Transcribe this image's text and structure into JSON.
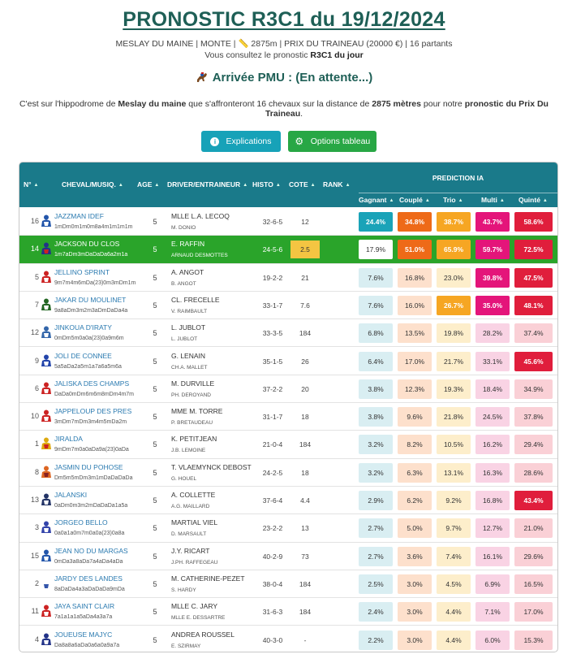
{
  "page": {
    "title": "PRONOSTIC R3C1 du 19/12/2024",
    "meta": "MESLAY DU MAINE | MONTE | 📏 2875m | PRIX DU TRAINEAU (20000 €) | 16 partants",
    "sub_prefix": "Vous consultez le pronostic ",
    "sub_bold": "R3C1 du jour",
    "arrivee": "Arrivée PMU : (En attente...)",
    "intro_1": "C'est sur l'hippodrome de ",
    "intro_place": "Meslay du maine",
    "intro_2": " que s'affronteront 16 chevaux sur la distance de ",
    "intro_dist": "2875 mètres",
    "intro_3": " pour notre ",
    "intro_prix": "pronostic du Prix Du Traineau",
    "intro_4": "."
  },
  "buttons": {
    "explications": "Explications",
    "options": "Options tableau"
  },
  "headers": {
    "num": "N°",
    "cheval": "CHEVAL/MUSIQ.",
    "age": "AGE",
    "driver": "DRIVER/ENTRAINEUR",
    "histo": "HISTO",
    "cote": "COTE",
    "rank": "RANK",
    "prediction": "PREDICTION IA",
    "gagnant": "Gagnant",
    "couple": "Couplé",
    "trio": "Trio",
    "multi": "Multi",
    "quinte": "Quinté"
  },
  "colors": {
    "header_bg": "#1a7a8a",
    "highlight_row": "#2aa42a",
    "title": "#1e5f56"
  },
  "rows": [
    {
      "num": "16",
      "name": "JAZZMAN IDEF",
      "mus": "1mDm0m1m0m8a4m1m1m1m",
      "age": "5",
      "driver": "Mlle L.A. LECOQ",
      "trainer": "M. DONIO",
      "histo": "32-6-5",
      "cote": "12",
      "p": [
        "24.4%",
        "34.8%",
        "38.7%",
        "43.7%",
        "58.6%"
      ],
      "silk": [
        "#2255aa",
        "#ffffff"
      ]
    },
    {
      "num": "14",
      "name": "JACKSON DU CLOS",
      "mus": "1m7aDm3mDaDaDa6a2m1a",
      "age": "5",
      "driver": "E. RAFFIN",
      "trainer": "ARNAUD DESMOTTES",
      "histo": "24-5-6",
      "cote": "2.5",
      "p": [
        "17.9%",
        "51.0%",
        "65.9%",
        "59.7%",
        "72.5%"
      ],
      "silk": [
        "#223388",
        "#cc2222"
      ],
      "highlight": true
    },
    {
      "num": "5",
      "name": "JELLINO SPRINT",
      "mus": "9m7m4m6mDa(23)0m3mDm1m",
      "age": "5",
      "driver": "A. ANGOT",
      "trainer": "B. ANGOT",
      "histo": "19-2-2",
      "cote": "21",
      "p": [
        "7.6%",
        "16.8%",
        "23.0%",
        "39.8%",
        "47.5%"
      ],
      "silk": [
        "#cc2222",
        "#ffffff"
      ]
    },
    {
      "num": "7",
      "name": "JAKAR DU MOULINET",
      "mus": "9a8aDm3m2m3aDmDaDa4a",
      "age": "5",
      "driver": "CL. FRECELLE",
      "trainer": "V. RAIMBAULT",
      "histo": "33-1-7",
      "cote": "7.6",
      "p": [
        "7.6%",
        "16.0%",
        "26.7%",
        "35.0%",
        "48.1%"
      ],
      "silk": [
        "#226622",
        "#ffffff"
      ]
    },
    {
      "num": "12",
      "name": "JINKOUA D'IRATY",
      "mus": "0mDm5m0a0a(23)0a9m6m",
      "age": "5",
      "driver": "L. JUBLOT",
      "trainer": "L. JUBLOT",
      "histo": "33-3-5",
      "cote": "184",
      "p": [
        "6.8%",
        "13.5%",
        "19.8%",
        "28.2%",
        "37.4%"
      ],
      "silk": [
        "#3366aa",
        "#ffffff"
      ]
    },
    {
      "num": "9",
      "name": "JOLI DE CONNEE",
      "mus": "5a5aDa2a5m1a7a6a5m6a",
      "age": "5",
      "driver": "G. LENAIN",
      "trainer": "CH.A. MALLET",
      "histo": "35-1-5",
      "cote": "26",
      "p": [
        "6.4%",
        "17.0%",
        "21.7%",
        "33.1%",
        "45.6%"
      ],
      "silk": [
        "#2244aa",
        "#ffffff"
      ]
    },
    {
      "num": "6",
      "name": "JALISKA DES CHAMPS",
      "mus": "DaDa0mDm6m6m8mDm4m7m",
      "age": "5",
      "driver": "M. DURVILLE",
      "trainer": "PH. DEROYAND",
      "histo": "37-2-2",
      "cote": "20",
      "p": [
        "3.8%",
        "12.3%",
        "19.3%",
        "18.4%",
        "34.9%"
      ],
      "silk": [
        "#cc2222",
        "#ffffff"
      ]
    },
    {
      "num": "10",
      "name": "JAPPELOUP DES PRES",
      "mus": "3mDm7mDm3m4m5mDa2m",
      "age": "5",
      "driver": "Mme M. TORRE",
      "trainer": "P. BRETAUDEAU",
      "histo": "31-1-7",
      "cote": "18",
      "p": [
        "3.8%",
        "9.6%",
        "21.8%",
        "24.5%",
        "37.8%"
      ],
      "silk": [
        "#cc2222",
        "#ffffff"
      ]
    },
    {
      "num": "1",
      "name": "JIRALDA",
      "mus": "9mDm7m0a0aDa9a(23)0aDa",
      "age": "5",
      "driver": "K. PETITJEAN",
      "trainer": "J.B. LEMOINE",
      "histo": "21-0-4",
      "cote": "184",
      "p": [
        "3.2%",
        "8.2%",
        "10.5%",
        "16.2%",
        "29.4%"
      ],
      "silk": [
        "#ddaa11",
        "#cc2222"
      ]
    },
    {
      "num": "8",
      "name": "JASMIN DU POHOSE",
      "mus": "Dm5m5mDm3m1mDaDaDaDa",
      "age": "5",
      "driver": "T. VLAEMYNCK DEBOST",
      "trainer": "G. HOUEL",
      "histo": "24-2-5",
      "cote": "18",
      "p": [
        "3.2%",
        "6.3%",
        "13.1%",
        "16.3%",
        "28.6%"
      ],
      "silk": [
        "#dd6622",
        "#882222"
      ]
    },
    {
      "num": "13",
      "name": "JALANSKI",
      "mus": "0aDm0m3m2mDaDaDa1a5a",
      "age": "5",
      "driver": "A. COLLETTE",
      "trainer": "A.G. MAILLARD",
      "histo": "37-6-4",
      "cote": "4.4",
      "p": [
        "2.9%",
        "6.2%",
        "9.2%",
        "16.8%",
        "43.4%"
      ],
      "silk": [
        "#223366",
        "#ffffff"
      ]
    },
    {
      "num": "3",
      "name": "JORGEO BELLO",
      "mus": "0a0a1a0m7m0a0a(23)0a8a",
      "age": "5",
      "driver": "MARTIAL VIEL",
      "trainer": "D. MARSAULT",
      "histo": "23-2-2",
      "cote": "13",
      "p": [
        "2.7%",
        "5.0%",
        "9.7%",
        "12.7%",
        "21.0%"
      ],
      "silk": [
        "#3344aa",
        "#ffffff"
      ]
    },
    {
      "num": "15",
      "name": "JEAN NO DU MARGAS",
      "mus": "0mDa3a8aDa7a4aDa4aDa",
      "age": "5",
      "driver": "J.Y. RICART",
      "trainer": "J.PH. RAFFEGEAU",
      "histo": "40-2-9",
      "cote": "73",
      "p": [
        "2.7%",
        "3.6%",
        "7.4%",
        "16.1%",
        "29.6%"
      ],
      "silk": [
        "#2255aa",
        "#ffffff"
      ]
    },
    {
      "num": "2",
      "name": "JARDY DES LANDES",
      "mus": "8aDaDa4a3aDaDaDa9mDa",
      "age": "5",
      "driver": "M. CATHERINE-PEZET",
      "trainer": "S. HARDY",
      "histo": "38-0-4",
      "cote": "184",
      "p": [
        "2.5%",
        "3.0%",
        "4.5%",
        "6.9%",
        "16.5%"
      ],
      "silk": [
        "#ffffff",
        "#3355aa"
      ]
    },
    {
      "num": "11",
      "name": "JAYA SAINT CLAIR",
      "mus": "7a1a1a1a5aDa4a3a7a",
      "age": "5",
      "driver": "Mlle C. JARY",
      "trainer": "Mlle E. DESSARTRE",
      "histo": "31-6-3",
      "cote": "184",
      "p": [
        "2.4%",
        "3.0%",
        "4.4%",
        "7.1%",
        "17.0%"
      ],
      "silk": [
        "#cc2222",
        "#ffffff"
      ]
    },
    {
      "num": "4",
      "name": "JOUEUSE MAJYC",
      "mus": "Da8a8a6aDa0a6a0a9a7a",
      "age": "5",
      "driver": "ANDREA ROUSSEL",
      "trainer": "E. SZIRMAY",
      "histo": "40-3-0",
      "cote": "-",
      "p": [
        "2.2%",
        "3.0%",
        "4.4%",
        "6.0%",
        "15.3%"
      ],
      "silk": [
        "#223388",
        "#ffffff"
      ]
    }
  ]
}
